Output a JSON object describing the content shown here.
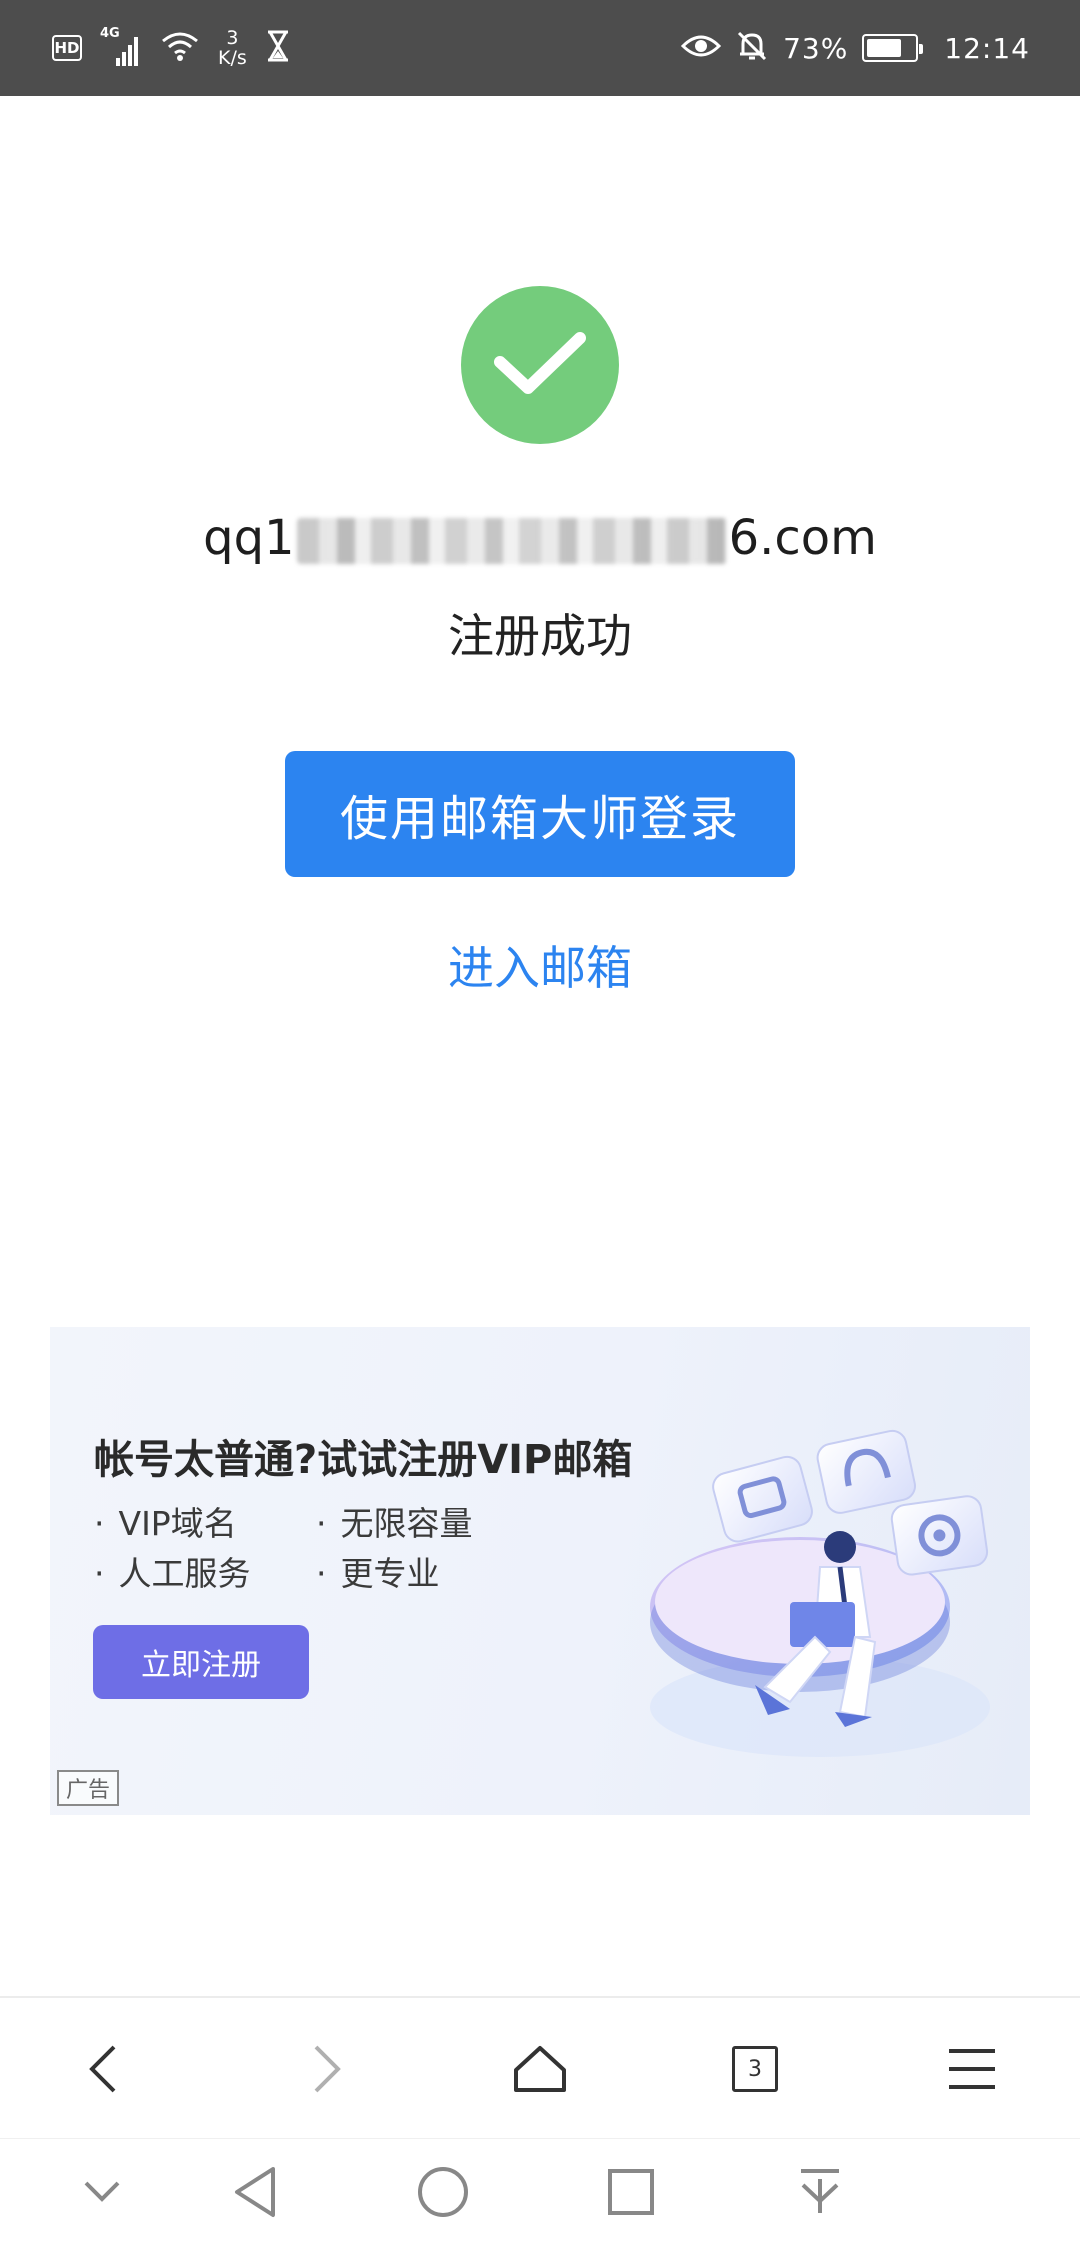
{
  "status_bar": {
    "hd": "HD",
    "network": "4G",
    "speed_value": "3",
    "speed_unit": "K/s",
    "battery": "73%",
    "battery_level": 0.73,
    "time": "12:14"
  },
  "result": {
    "email_start": "qq1",
    "email_end": "6.com",
    "message": "注册成功"
  },
  "actions": {
    "login_button": "使用邮箱大师登录",
    "enter_mailbox": "进入邮箱"
  },
  "ad": {
    "title": "帐号太普通?试试注册VIP邮箱",
    "features": [
      "VIP域名",
      "无限容量",
      "人工服务",
      "更专业"
    ],
    "cta": "立即注册",
    "tag": "广告",
    "colors": {
      "cta": "#6e6ee6"
    }
  },
  "browser_bar": {
    "tab_count": "3",
    "icons": [
      "back-icon",
      "forward-icon",
      "home-icon",
      "tabs-icon",
      "menu-icon"
    ]
  },
  "system_nav": {
    "icons": [
      "collapse-icon",
      "nav-back-icon",
      "nav-home-icon",
      "nav-recents-icon",
      "download-icon"
    ]
  },
  "colors": {
    "primary": "#2c84f0",
    "success": "#74cc7c",
    "status_bar": "#4d4d4d"
  }
}
